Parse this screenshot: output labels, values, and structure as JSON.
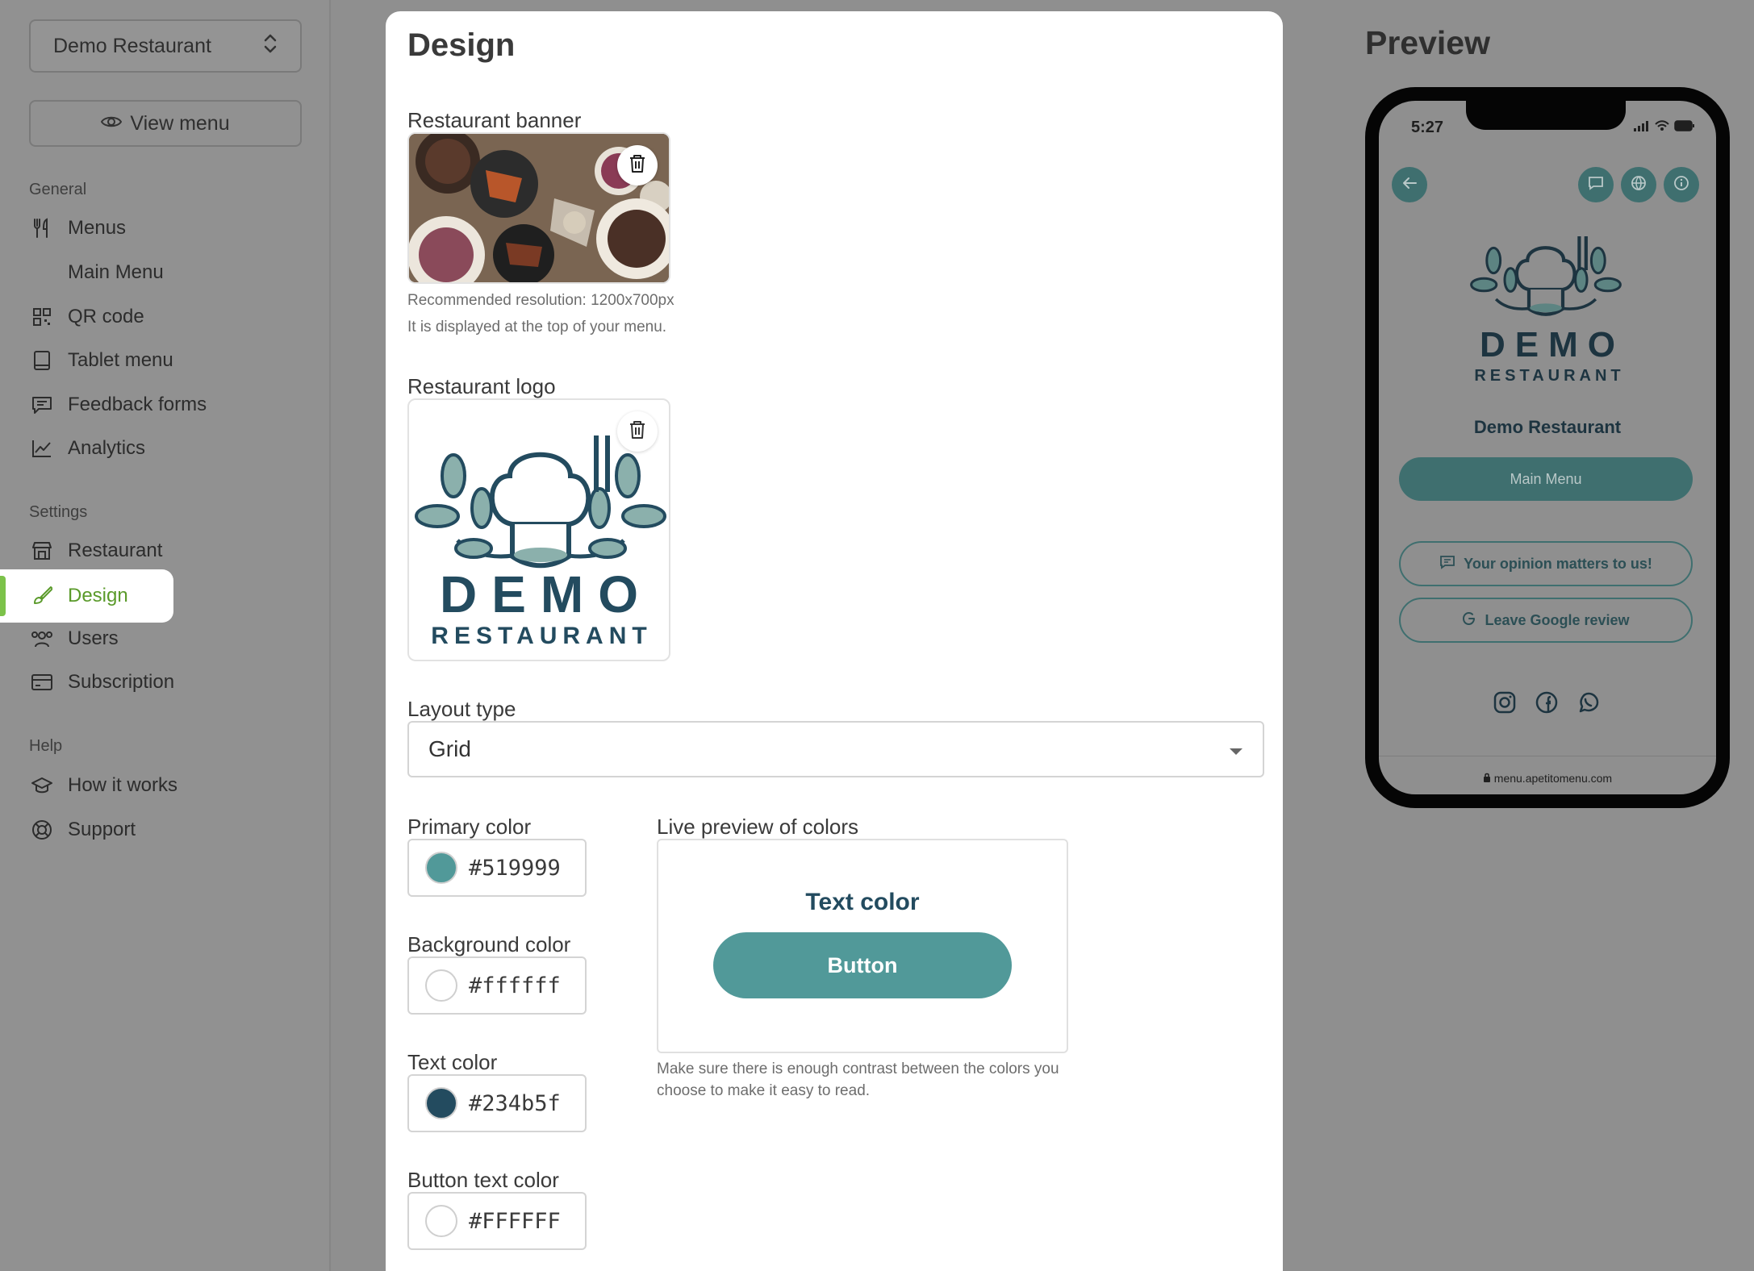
{
  "sidebar": {
    "restaurant_select": "Demo Restaurant",
    "view_menu_label": "View menu",
    "sections": {
      "general": "General",
      "settings": "Settings",
      "help": "Help"
    },
    "items": {
      "menus": "Menus",
      "main_menu": "Main Menu",
      "qr_code": "QR code",
      "tablet_menu": "Tablet menu",
      "feedback_forms": "Feedback forms",
      "analytics": "Analytics",
      "restaurant": "Restaurant",
      "design": "Design",
      "users": "Users",
      "subscription": "Subscription",
      "how_it_works": "How it works",
      "support": "Support"
    },
    "icons": {
      "menus": "fork-knife-icon",
      "qr_code": "qr-code-icon",
      "tablet_menu": "tablet-icon",
      "feedback_forms": "message-icon",
      "analytics": "chart-line-icon",
      "restaurant": "store-icon",
      "design": "brush-icon",
      "users": "users-icon",
      "subscription": "credit-card-icon",
      "how_it_works": "graduation-cap-icon",
      "support": "lifebuoy-icon"
    }
  },
  "design": {
    "title": "Design",
    "banner_label": "Restaurant banner",
    "banner_hint_1": "Recommended resolution: 1200x700px",
    "banner_hint_2": "It is displayed at the top of your menu.",
    "logo_label": "Restaurant logo",
    "logo_text_1": "DEMO",
    "logo_text_2": "RESTAURANT",
    "layout_label": "Layout type",
    "layout_value": "Grid",
    "primary_label": "Primary color",
    "primary_value": "#519999",
    "background_label": "Background color",
    "background_value": "#ffffff",
    "text_label": "Text color",
    "text_value": "#234b5f",
    "button_text_label": "Button text color",
    "button_text_value": "#FFFFFF",
    "live_label": "Live preview of colors",
    "live_text": "Text color",
    "live_button": "Button",
    "contrast_hint": "Make sure there is enough contrast between the colors you choose to make it easy to read."
  },
  "preview": {
    "title": "Preview",
    "time": "5:27",
    "logo_text_1": "DEMO",
    "logo_text_2": "RESTAURANT",
    "restaurant_name": "Demo Restaurant",
    "main_menu_button": "Main Menu",
    "opinion_button": "Your opinion matters to us!",
    "google_button": "Leave Google review",
    "url": "menu.apetitomenu.com"
  },
  "colors": {
    "primary": "#519999",
    "background": "#ffffff",
    "text": "#234b5f",
    "button_text": "#FFFFFF",
    "active_nav": "#5a9a2a"
  }
}
